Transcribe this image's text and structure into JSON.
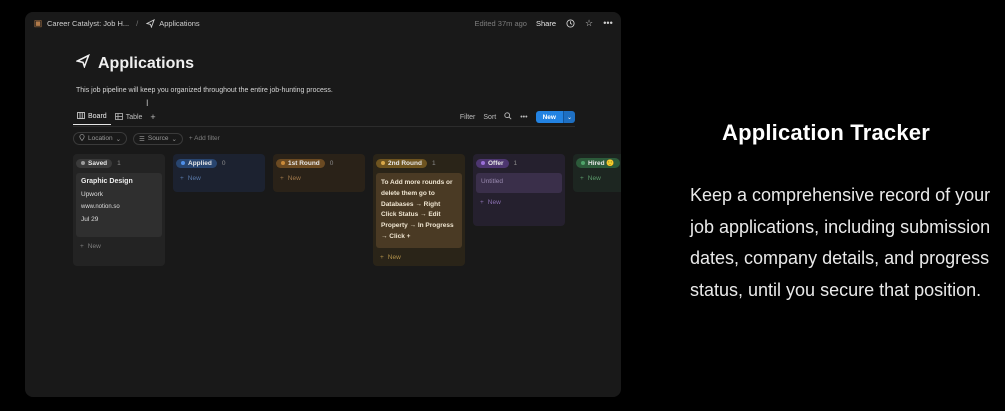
{
  "window": {
    "breadcrumb": {
      "workspace": "Career Catalyst: Job H...",
      "separator": "/",
      "page": "Applications"
    },
    "edited": "Edited 37m ago",
    "share_label": "Share",
    "icons": [
      "clock-icon",
      "star-icon",
      "more-icon"
    ]
  },
  "page": {
    "title": "Applications",
    "description": "This job pipeline will keep you organized throughout the entire job-hunting process."
  },
  "views": {
    "tabs": [
      {
        "label": "Board",
        "icon": "board-icon"
      },
      {
        "label": "Table",
        "icon": "table-icon"
      }
    ],
    "add_label": "+",
    "filter_label": "Filter",
    "sort_label": "Sort",
    "new_label": "New"
  },
  "filters": {
    "location": "Location",
    "source": "Source",
    "add_filter": "+ Add filter"
  },
  "board": {
    "columns": [
      {
        "name": "Saved",
        "count": "1",
        "color": "#9b9b9b",
        "bg": "#232323"
      },
      {
        "name": "Applied",
        "count": "0",
        "color": "#4f8fe8",
        "bg": "#1c2230"
      },
      {
        "name": "1st Round",
        "count": "0",
        "color": "#c98a3a",
        "bg": "#2a2218"
      },
      {
        "name": "2nd Round",
        "count": "1",
        "color": "#d8a84a",
        "bg": "#2a2418"
      },
      {
        "name": "Offer",
        "count": "1",
        "color": "#9a6fd8",
        "bg": "#25202e"
      },
      {
        "name": "Hired 🙂",
        "count": "0",
        "color": "#4fa36a",
        "bg": "#1d2621"
      }
    ],
    "cards": {
      "saved": {
        "title": "Graphic Design",
        "company": "Upwork",
        "url": "www.notion.so",
        "date": "Jul 29"
      },
      "second_round": "To Add more rounds or delete them go to Databases → Right Click Status → Edit Property → In Progress → Click +",
      "offer": "Untitled"
    },
    "new_label": "New",
    "new_plus": "+"
  },
  "marketing": {
    "title": "Application Tracker",
    "body": "Keep a comprehensive record of your job applications, including submission dates, company details, and progress status, until you secure that position."
  }
}
